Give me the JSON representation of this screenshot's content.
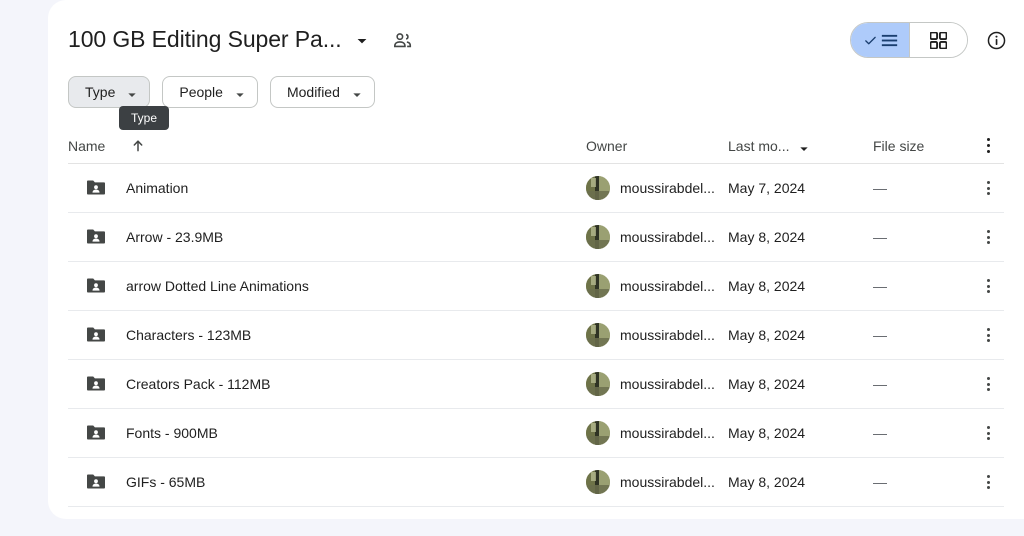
{
  "window": {
    "background_color": "#f4f5fb",
    "panel_color": "#ffffff"
  },
  "header": {
    "title": "100 GB Editing Super Pa...",
    "title_caret_icon": "chevron-down-icon",
    "shared_icon": "people-shared-icon",
    "view_toggle": {
      "list_label": "list-view",
      "list_selected": true,
      "list_icon": "check-list-icon",
      "grid_label": "grid-view",
      "grid_selected": false,
      "grid_icon": "grid-view-icon",
      "selected_color": "#aecbfa"
    },
    "info_icon": "info-circle-icon"
  },
  "filters": {
    "chips": [
      {
        "label": "Type",
        "hovered": true,
        "caret_icon": "chevron-down-icon"
      },
      {
        "label": "People",
        "hovered": false,
        "caret_icon": "chevron-down-icon"
      },
      {
        "label": "Modified",
        "hovered": false,
        "caret_icon": "chevron-down-icon"
      }
    ],
    "tooltip": {
      "text": "Type",
      "background_color": "#3c4043"
    }
  },
  "table": {
    "columns": {
      "name": "Name",
      "name_sort_icon": "sort-arrow-up-icon",
      "owner": "Owner",
      "modified": "Last mo...",
      "modified_caret_icon": "chevron-down-icon",
      "size": "File size",
      "menu_icon": "kebab-menu-icon"
    },
    "rows": [
      {
        "icon": "shared-folder-icon",
        "name": "Animation",
        "owner": "moussirabdel...",
        "modified": "May 7, 2024",
        "size": "—"
      },
      {
        "icon": "shared-folder-icon",
        "name": "Arrow - 23.9MB",
        "owner": "moussirabdel...",
        "modified": "May 8, 2024",
        "size": "—"
      },
      {
        "icon": "shared-folder-icon",
        "name": "arrow Dotted Line Animations",
        "owner": "moussirabdel...",
        "modified": "May 8, 2024",
        "size": "—"
      },
      {
        "icon": "shared-folder-icon",
        "name": "Characters - 123MB",
        "owner": "moussirabdel...",
        "modified": "May 8, 2024",
        "size": "—"
      },
      {
        "icon": "shared-folder-icon",
        "name": "Creators Pack - 112MB",
        "owner": "moussirabdel...",
        "modified": "May 8, 2024",
        "size": "—"
      },
      {
        "icon": "shared-folder-icon",
        "name": "Fonts - 900MB",
        "owner": "moussirabdel...",
        "modified": "May 8, 2024",
        "size": "—"
      },
      {
        "icon": "shared-folder-icon",
        "name": "GIFs - 65MB",
        "owner": "moussirabdel...",
        "modified": "May 8, 2024",
        "size": "—"
      }
    ]
  }
}
